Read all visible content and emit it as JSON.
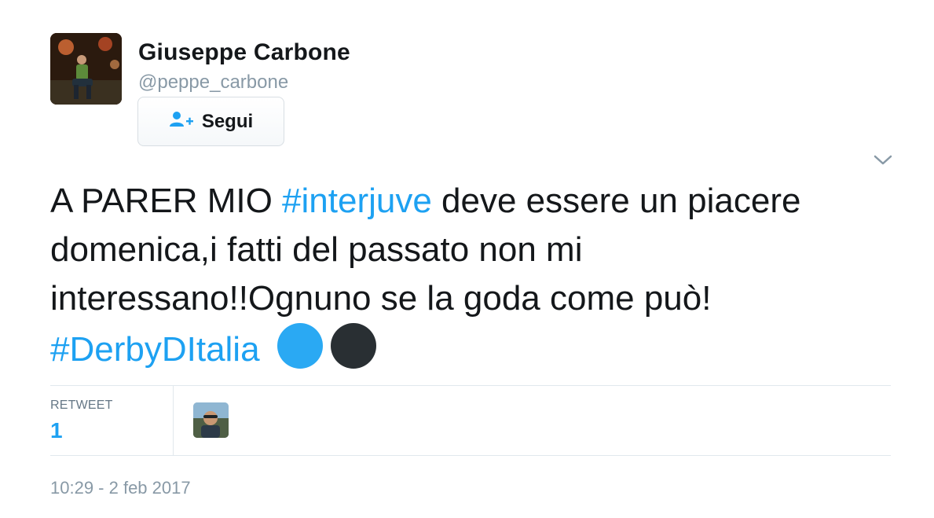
{
  "author": {
    "name": "Giuseppe Carbone",
    "handle": "@peppe_carbone"
  },
  "follow_button": {
    "label": "Segui",
    "icon": "add-user-icon"
  },
  "tweet": {
    "text_part1": "A PARER MIO ",
    "hashtag1": "#interjuve",
    "text_part2": " deve essere un piacere domenica,i fatti del passato non mi interessano!!Ognuno se la goda come può!",
    "hashtag2": "#DerbyDItalia",
    "emojis": [
      "blue-circle",
      "black-circle"
    ]
  },
  "stats": {
    "retweet_label": "RETWEET",
    "retweet_count": "1"
  },
  "timestamp": "10:29 - 2 feb 2017",
  "colors": {
    "accent": "#1da1f2",
    "text": "#14171a",
    "muted": "#8899a6",
    "emoji_blue": "#2aa9f3",
    "emoji_black": "#292f33"
  }
}
